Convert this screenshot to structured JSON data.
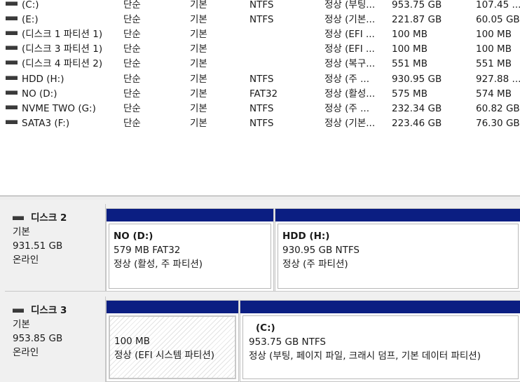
{
  "volumes": [
    {
      "name": "(C:)",
      "layout": "단순",
      "type": "기본",
      "fs": "NTFS",
      "status": "정상 (부팅...",
      "capacity": "953.75 GB",
      "free": "107.45 ..."
    },
    {
      "name": "(E:)",
      "layout": "단순",
      "type": "기본",
      "fs": "NTFS",
      "status": "정상 (기본...",
      "capacity": "221.87 GB",
      "free": "60.05 GB"
    },
    {
      "name": "(디스크 1 파티션 1)",
      "layout": "단순",
      "type": "기본",
      "fs": "",
      "status": "정상 (EFI ...",
      "capacity": "100 MB",
      "free": "100 MB"
    },
    {
      "name": "(디스크 3 파티션 1)",
      "layout": "단순",
      "type": "기본",
      "fs": "",
      "status": "정상 (EFI ...",
      "capacity": "100 MB",
      "free": "100 MB"
    },
    {
      "name": "(디스크 4 파티션 2)",
      "layout": "단순",
      "type": "기본",
      "fs": "",
      "status": "정상 (복구...",
      "capacity": "551 MB",
      "free": "551 MB"
    },
    {
      "name": "HDD (H:)",
      "layout": "단순",
      "type": "기본",
      "fs": "NTFS",
      "status": "정상 (주 ...",
      "capacity": "930.95 GB",
      "free": "927.88 ..."
    },
    {
      "name": "NO (D:)",
      "layout": "단순",
      "type": "기본",
      "fs": "FAT32",
      "status": "정상 (활성...",
      "capacity": "575 MB",
      "free": "574 MB"
    },
    {
      "name": "NVME TWO (G:)",
      "layout": "단순",
      "type": "기본",
      "fs": "NTFS",
      "status": "정상 (주 ...",
      "capacity": "232.34 GB",
      "free": "60.82 GB"
    },
    {
      "name": "SATA3 (F:)",
      "layout": "단순",
      "type": "기본",
      "fs": "NTFS",
      "status": "정상 (기본...",
      "capacity": "223.46 GB",
      "free": "76.30 GB"
    }
  ],
  "disks": [
    {
      "title": "디스크 2",
      "type": "기본",
      "size": "931.51 GB",
      "state": "온라인",
      "partitions": [
        {
          "name": "NO  (D:)",
          "size_fs": "579 MB FAT32",
          "status": "정상 (활성, 주 파티션)"
        },
        {
          "name": "HDD  (H:)",
          "size_fs": "930.95 GB NTFS",
          "status": "정상 (주 파티션)"
        }
      ]
    },
    {
      "title": "디스크 3",
      "type": "기본",
      "size": "953.85 GB",
      "state": "온라인",
      "partitions": [
        {
          "name": "",
          "size_fs": "100 MB",
          "status": "정상 (EFI 시스템 파티션)"
        },
        {
          "name": "(C:)",
          "size_fs": "953.75 GB NTFS",
          "status": "정상 (부팅, 페이지 파일, 크래시 덤프, 기본 데이터 파티션)"
        }
      ]
    }
  ],
  "icons": {
    "drive": "drive-icon",
    "disk": "disk-icon"
  },
  "colors": {
    "partition_bar": "#0b1e82",
    "background": "#f0f0f0"
  }
}
